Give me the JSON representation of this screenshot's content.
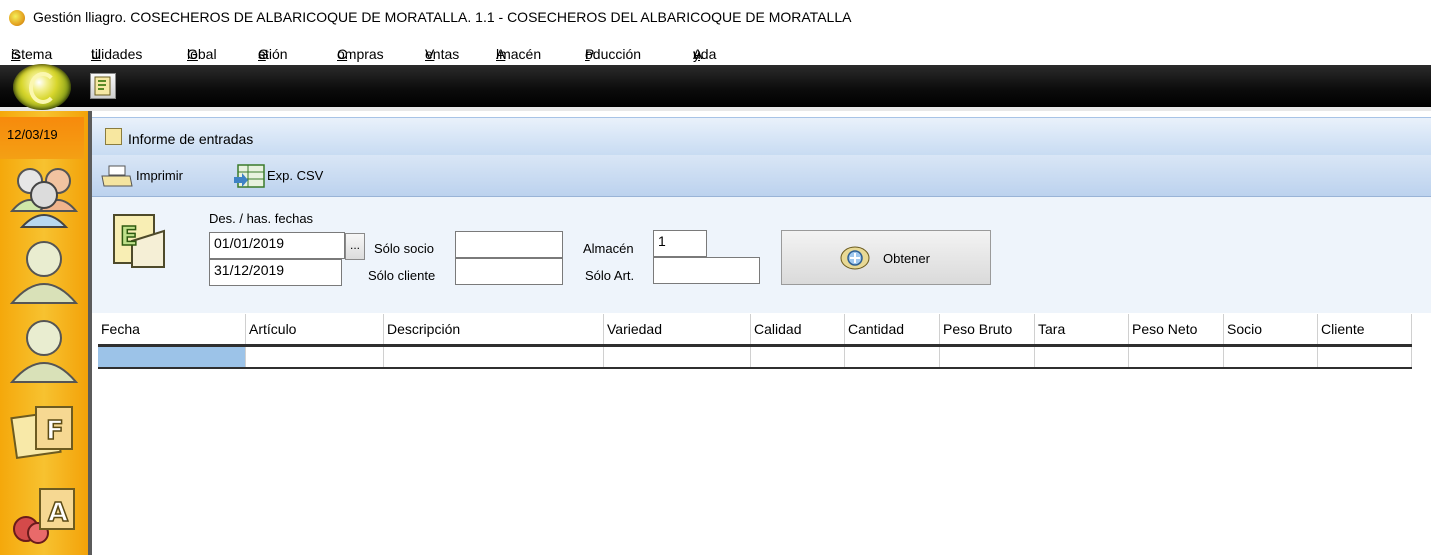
{
  "window": {
    "title": "Gestión lliagro. COSECHEROS DE ALBARICOQUE DE MORATALLA. 1.1 - COSECHEROS DEL ALBARICOQUE DE MORATALLA"
  },
  "menu": [
    {
      "pre": "",
      "key": "S",
      "post": "istema"
    },
    {
      "pre": "",
      "key": "U",
      "post": "tilidades"
    },
    {
      "pre": "",
      "key": "G",
      "post": "lobal"
    },
    {
      "pre": "G",
      "key": "e",
      "post": "stión"
    },
    {
      "pre": "",
      "key": "C",
      "post": "ompras"
    },
    {
      "pre": "",
      "key": "V",
      "post": "entas"
    },
    {
      "pre": "",
      "key": "A",
      "post": "lmacén"
    },
    {
      "pre": "P",
      "key": "r",
      "post": "oducción"
    },
    {
      "pre": "A",
      "key": "y",
      "post": "uda"
    }
  ],
  "sidebar": {
    "date": "12/03/19",
    "icons": [
      "users-group-icon",
      "user-icon",
      "user-icon",
      "form-f-icon",
      "form-a-icon"
    ]
  },
  "panel": {
    "title": "Informe de entradas"
  },
  "ribbon": {
    "print_label": "Imprimir",
    "csv_label": "Exp. CSV"
  },
  "filters": {
    "date_range_label": "Des. / has. fechas",
    "date_from": "01/01/2019",
    "date_to": "31/12/2019",
    "dots_label": "...",
    "socio_label": "Sólo socio",
    "socio_value": "",
    "cliente_label": "Sólo cliente",
    "cliente_value": "",
    "almacen_label": "Almacén",
    "almacen_value": "1",
    "articulo_label": "Sólo Art.",
    "articulo_value": "",
    "obtener_label": "Obtener"
  },
  "grid": {
    "columns": [
      "Fecha",
      "Artículo",
      "Descripción",
      "Variedad",
      "Calidad",
      "Cantidad",
      "Peso Bruto",
      "Tara",
      "Peso Neto",
      "Socio",
      "Cliente"
    ],
    "rows": [
      [
        "",
        "",
        "",
        "",
        "",
        "",
        "",
        "",
        "",
        "",
        ""
      ]
    ]
  },
  "colors": {
    "sidebar": "#f7b81e",
    "ribbon": "#c9dbf1",
    "selected_cell": "#9cc3e8",
    "toolbar": "#0b0b0b"
  }
}
